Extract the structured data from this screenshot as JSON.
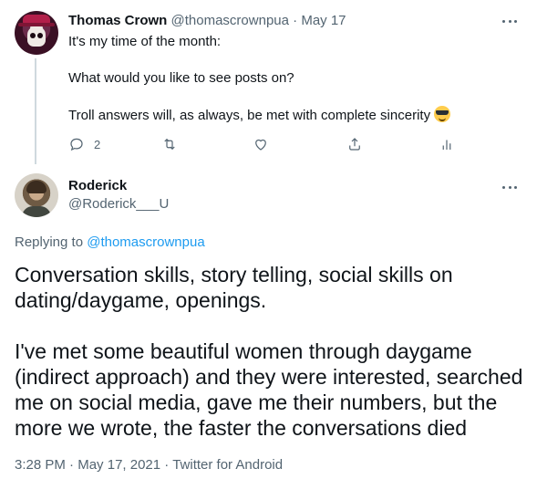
{
  "parent_tweet": {
    "author_name": "Thomas Crown",
    "author_handle": "@thomascrownpua",
    "separator": "·",
    "date": "May 17",
    "lines": [
      "It's my time of the month:",
      "What would you like to see posts on?",
      "Troll answers will, as always, be met with complete sincerity"
    ],
    "emoji": "smiling-face-with-sunglasses",
    "actions": {
      "reply_count": "2"
    }
  },
  "reply_tweet": {
    "author_name": "Roderick",
    "author_handle": "@Roderick___U",
    "replying_to_prefix": "Replying to",
    "replying_to_handle": "@thomascrownpua",
    "body_lines_1": [
      "Conversation skills, story telling, social skills on",
      "dating/daygame, openings."
    ],
    "body_lines_2": [
      "I've met some beautiful women through daygame",
      "(indirect approach) and they were interested, searched",
      "me on social media, gave me their numbers, but the",
      "more we wrote, the faster the conversations died"
    ],
    "time": "3:28 PM",
    "separator": "·",
    "date": "May 17, 2021",
    "source": "Twitter for Android"
  },
  "colors": {
    "text": "#0f1419",
    "secondary": "#536471",
    "link": "#1d9bf0",
    "thread_line": "#cfd9de"
  }
}
